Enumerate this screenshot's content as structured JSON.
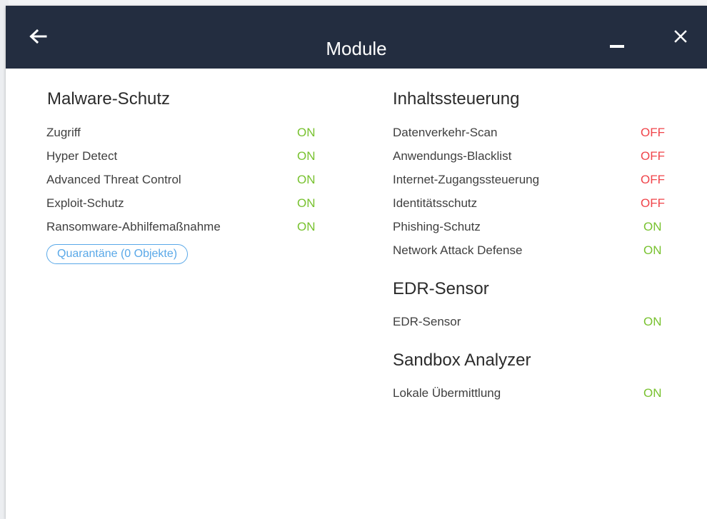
{
  "window": {
    "title": "Module",
    "back_icon": "arrow-left-icon",
    "minimize_icon": "minimize-icon",
    "close_icon": "close-icon"
  },
  "colors": {
    "titlebar_bg": "#232d40",
    "on": "#78c22f",
    "off": "#f0444a",
    "link": "#59a8e8"
  },
  "sections": {
    "malware": {
      "title": "Malware-Schutz",
      "items": [
        {
          "label": "Zugriff",
          "status": "ON"
        },
        {
          "label": "Hyper Detect",
          "status": "ON"
        },
        {
          "label": "Advanced Threat Control",
          "status": "ON"
        },
        {
          "label": "Exploit-Schutz",
          "status": "ON"
        },
        {
          "label": "Ransomware-Abhilfemaßnahme",
          "status": "ON"
        }
      ],
      "quarantine_label": "Quarantäne (0 Objekte)"
    },
    "content": {
      "title": "Inhaltssteuerung",
      "items": [
        {
          "label": "Datenverkehr-Scan",
          "status": "OFF"
        },
        {
          "label": "Anwendungs-Blacklist",
          "status": "OFF"
        },
        {
          "label": "Internet-Zugangssteuerung",
          "status": "OFF"
        },
        {
          "label": "Identitätsschutz",
          "status": "OFF"
        },
        {
          "label": "Phishing-Schutz",
          "status": "ON"
        },
        {
          "label": "Network Attack Defense",
          "status": "ON"
        }
      ]
    },
    "edr": {
      "title": "EDR-Sensor",
      "items": [
        {
          "label": "EDR-Sensor",
          "status": "ON"
        }
      ]
    },
    "sandbox": {
      "title": "Sandbox Analyzer",
      "items": [
        {
          "label": "Lokale Übermittlung",
          "status": "ON"
        }
      ]
    }
  }
}
